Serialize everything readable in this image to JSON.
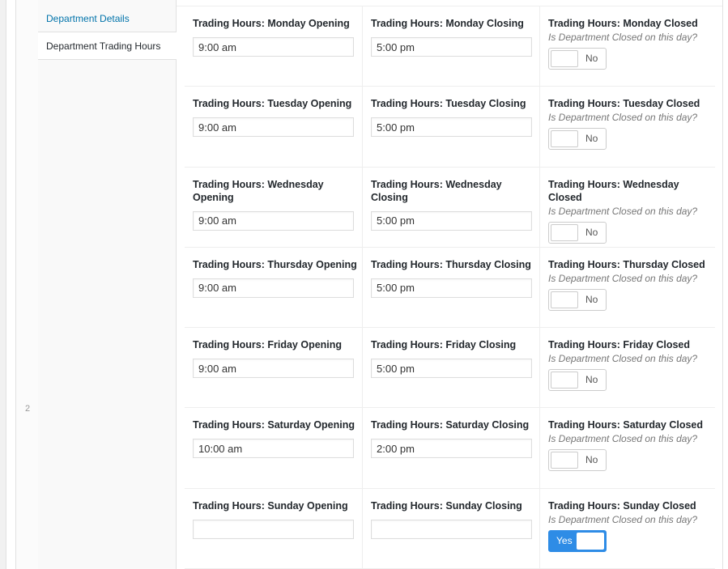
{
  "row_number": "2",
  "tabs": [
    {
      "label": "Department Details"
    },
    {
      "label": "Department Trading Hours"
    }
  ],
  "closed_hint": "Is Department Closed on this day?",
  "days": [
    {
      "opening_label": "Trading Hours: Monday Opening",
      "opening_value": "9:00 am",
      "closing_label": "Trading Hours: Monday Closing",
      "closing_value": "5:00 pm",
      "closed_label": "Trading Hours: Monday Closed",
      "closed_state": "No"
    },
    {
      "opening_label": "Trading Hours: Tuesday Opening",
      "opening_value": "9:00 am",
      "closing_label": "Trading Hours: Tuesday Closing",
      "closing_value": "5:00 pm",
      "closed_label": "Trading Hours: Tuesday Closed",
      "closed_state": "No"
    },
    {
      "opening_label": "Trading Hours: Wednesday Opening",
      "opening_value": "9:00 am",
      "closing_label": "Trading Hours: Wednesday Closing",
      "closing_value": "5:00 pm",
      "closed_label": "Trading Hours: Wednesday Closed",
      "closed_state": "No"
    },
    {
      "opening_label": "Trading Hours: Thursday Opening",
      "opening_value": "9:00 am",
      "closing_label": "Trading Hours: Thursday Closing",
      "closing_value": "5:00 pm",
      "closed_label": "Trading Hours: Thursday Closed",
      "closed_state": "No"
    },
    {
      "opening_label": "Trading Hours: Friday Opening",
      "opening_value": "9:00 am",
      "closing_label": "Trading Hours: Friday Closing",
      "closing_value": "5:00 pm",
      "closed_label": "Trading Hours: Friday Closed",
      "closed_state": "No"
    },
    {
      "opening_label": "Trading Hours: Saturday Opening",
      "opening_value": "10:00 am",
      "closing_label": "Trading Hours: Saturday Closing",
      "closing_value": "2:00 pm",
      "closed_label": "Trading Hours: Saturday Closed",
      "closed_state": "No"
    },
    {
      "opening_label": "Trading Hours: Sunday Opening",
      "opening_value": "",
      "closing_label": "Trading Hours: Sunday Closing",
      "closing_value": "",
      "closed_label": "Trading Hours: Sunday Closed",
      "closed_state": "Yes"
    }
  ],
  "colors": {
    "toggle_on": "#2e8ce6",
    "tab_link": "#0073aa"
  }
}
